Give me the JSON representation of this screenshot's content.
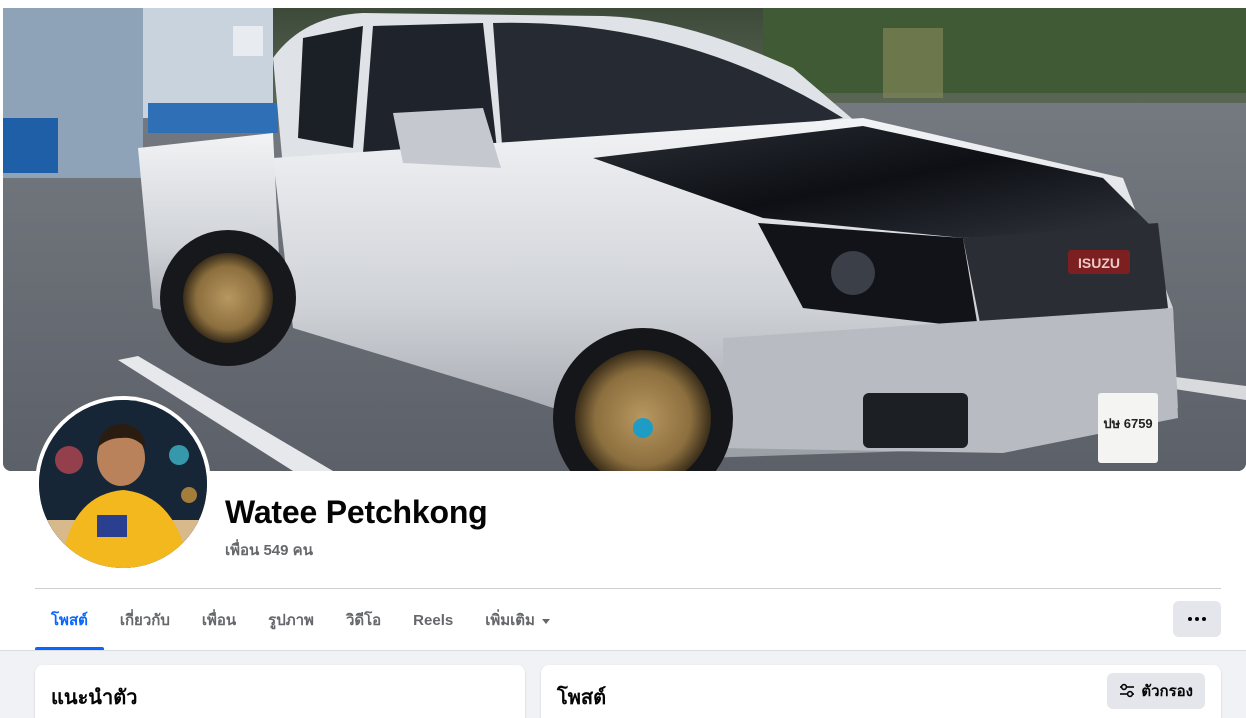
{
  "profile": {
    "name": "Watee Petchkong",
    "friends_label": "เพื่อน",
    "friends_count": "549",
    "friends_unit": "คน"
  },
  "cover": {
    "plate_text": "ปษ 6759",
    "brand_text": "ISUZU"
  },
  "tabs": [
    {
      "label": "โพสต์",
      "active": true
    },
    {
      "label": "เกี่ยวกับ",
      "active": false
    },
    {
      "label": "เพื่อน",
      "active": false
    },
    {
      "label": "รูปภาพ",
      "active": false
    },
    {
      "label": "วิดีโอ",
      "active": false
    },
    {
      "label": "Reels",
      "active": false
    },
    {
      "label": "เพิ่มเติม",
      "active": false
    }
  ],
  "more_options_icon": "ellipsis-icon",
  "intro_card": {
    "title": "แนะนำตัว"
  },
  "posts_card": {
    "title": "โพสต์",
    "filter_label": "ตัวกรอง",
    "filter_icon": "sliders-icon"
  },
  "colors": {
    "accent": "#0866ff",
    "secondary_text": "#65676b",
    "button_gray": "#e4e6eb",
    "page_bg": "#f0f2f5"
  }
}
